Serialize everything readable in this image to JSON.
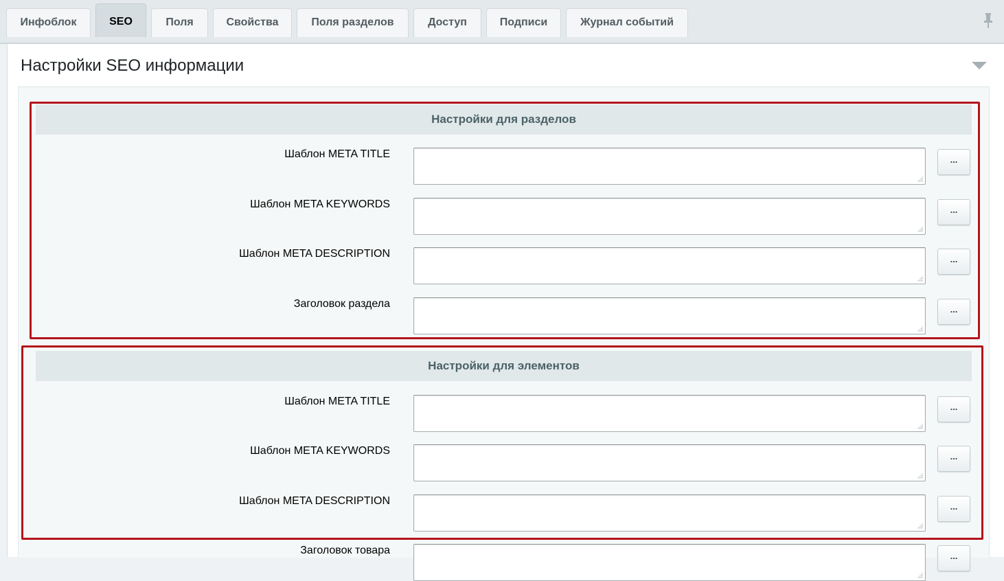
{
  "tabs": [
    {
      "label": "Инфоблок",
      "active": false
    },
    {
      "label": "SEO",
      "active": true
    },
    {
      "label": "Поля",
      "active": false
    },
    {
      "label": "Свойства",
      "active": false
    },
    {
      "label": "Поля разделов",
      "active": false
    },
    {
      "label": "Доступ",
      "active": false
    },
    {
      "label": "Подписи",
      "active": false
    },
    {
      "label": "Журнал событий",
      "active": false
    }
  ],
  "section": {
    "title": "Настройки SEO информации"
  },
  "sections_group": {
    "header": "Настройки для разделов",
    "rows": [
      {
        "label": "Шаблон META TITLE",
        "value": "",
        "button": "..."
      },
      {
        "label": "Шаблон META KEYWORDS",
        "value": "",
        "button": "..."
      },
      {
        "label": "Шаблон META DESCRIPTION",
        "value": "",
        "button": "..."
      },
      {
        "label": "Заголовок раздела",
        "value": "",
        "button": "..."
      }
    ]
  },
  "elements_group": {
    "header": "Настройки для элементов",
    "rows": [
      {
        "label": "Шаблон META TITLE",
        "value": "",
        "button": "..."
      },
      {
        "label": "Шаблон META KEYWORDS",
        "value": "",
        "button": "..."
      },
      {
        "label": "Шаблон META DESCRIPTION",
        "value": "",
        "button": "..."
      },
      {
        "label": "Заголовок товара",
        "value": "",
        "button": "..."
      }
    ]
  },
  "icons": {
    "pin": "pin-icon",
    "collapse": "chevron-down-icon"
  },
  "colors": {
    "highlight": "#b3141b",
    "group_header_bg": "#e1e8ea",
    "active_tab_bg": "#d6dde1"
  }
}
